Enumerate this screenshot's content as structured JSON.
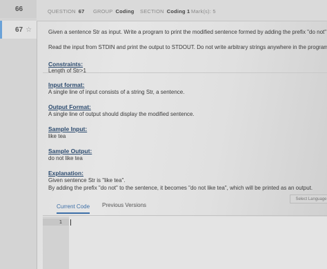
{
  "sidebar": {
    "prev_question": "66",
    "current_question": "67",
    "star_icon": "☆"
  },
  "header": {
    "question_label": "QUESTION",
    "question_value": "67",
    "group_label": "GROUP",
    "group_value": "Coding",
    "section_label": "SECTION",
    "section_value": "Coding 1",
    "marks_label": "Mark(s): 5"
  },
  "problem": {
    "intro": "Given a sentence Str as input. Write a program to print the modified sentence formed by adding the prefix \"do not\" to it.",
    "io_note": "Read the input from STDIN and print the output to STDOUT. Do not write arbitrary strings anywhere in the program, as these",
    "constraints_heading": "Constraints:",
    "constraints_text": "Length of Str>1",
    "input_heading": "Input format:",
    "input_text": "A single line of input consists of a string Str, a sentence.",
    "output_heading": "Output Format:",
    "output_text": "A single line of output should display the modified sentence.",
    "sample_input_heading": "Sample Input:",
    "sample_input_text": "like tea",
    "sample_output_heading": "Sample Output:",
    "sample_output_text": "do not like tea",
    "explanation_heading": "Explanation:",
    "explanation_line1": "Given sentence Str is \"like tea\".",
    "explanation_line2": "By adding the prefix \"do not\" to the sentence, it becomes \"do not like tea\", which will be printed as an output."
  },
  "editor": {
    "select_language": "Select Language",
    "tabs": [
      "Current Code",
      "Previous Versions"
    ],
    "line_number": "1"
  },
  "colors": {
    "accent": "#3c6fa8",
    "heading": "#2b4a6e"
  }
}
